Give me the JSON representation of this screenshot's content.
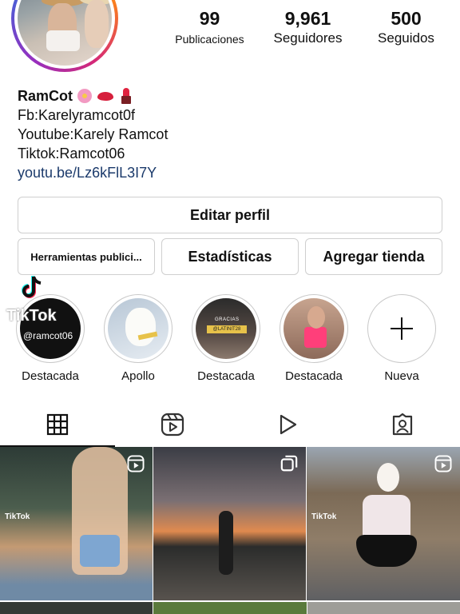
{
  "profile": {
    "stats": [
      {
        "value": "99",
        "label": "Publicaciones"
      },
      {
        "value": "9,961",
        "label": "Seguidores"
      },
      {
        "value": "500",
        "label": "Seguidos"
      }
    ],
    "name": "RamCot",
    "bio_lines": [
      "Fb:Karelyramcot0f",
      "Youtube:Karely Ramcot",
      "Tiktok:Ramcot06"
    ],
    "link": "youtu.be/Lz6kFlL3I7Y"
  },
  "buttons": {
    "edit": "Editar perfil",
    "tools": "Herramientas publici...",
    "stats": "Estadísticas",
    "shop": "Agregar tienda"
  },
  "highlights": [
    {
      "label": "Destacada",
      "tag": "@ramcot06"
    },
    {
      "label": "Apollo"
    },
    {
      "label": "Destacada",
      "caption": "GRACIAS",
      "badge": "@LATINIT28"
    },
    {
      "label": "Destacada"
    },
    {
      "label": "Nueva"
    }
  ],
  "overlay": {
    "tiktok_text": "TikTok"
  },
  "grid": {
    "tiktok_mark": "TikTok"
  },
  "icons": {
    "tabs": [
      "grid-icon",
      "reels-icon",
      "play-icon",
      "tagged-icon"
    ],
    "grid_items": [
      "reels-icon",
      "multi-post-icon",
      "reels-icon"
    ]
  },
  "colors": {
    "link": "#1b3a6b",
    "ring_gradient": [
      "#feda75",
      "#fa7e1e",
      "#d62976",
      "#962fbf",
      "#4f5bd5"
    ]
  }
}
